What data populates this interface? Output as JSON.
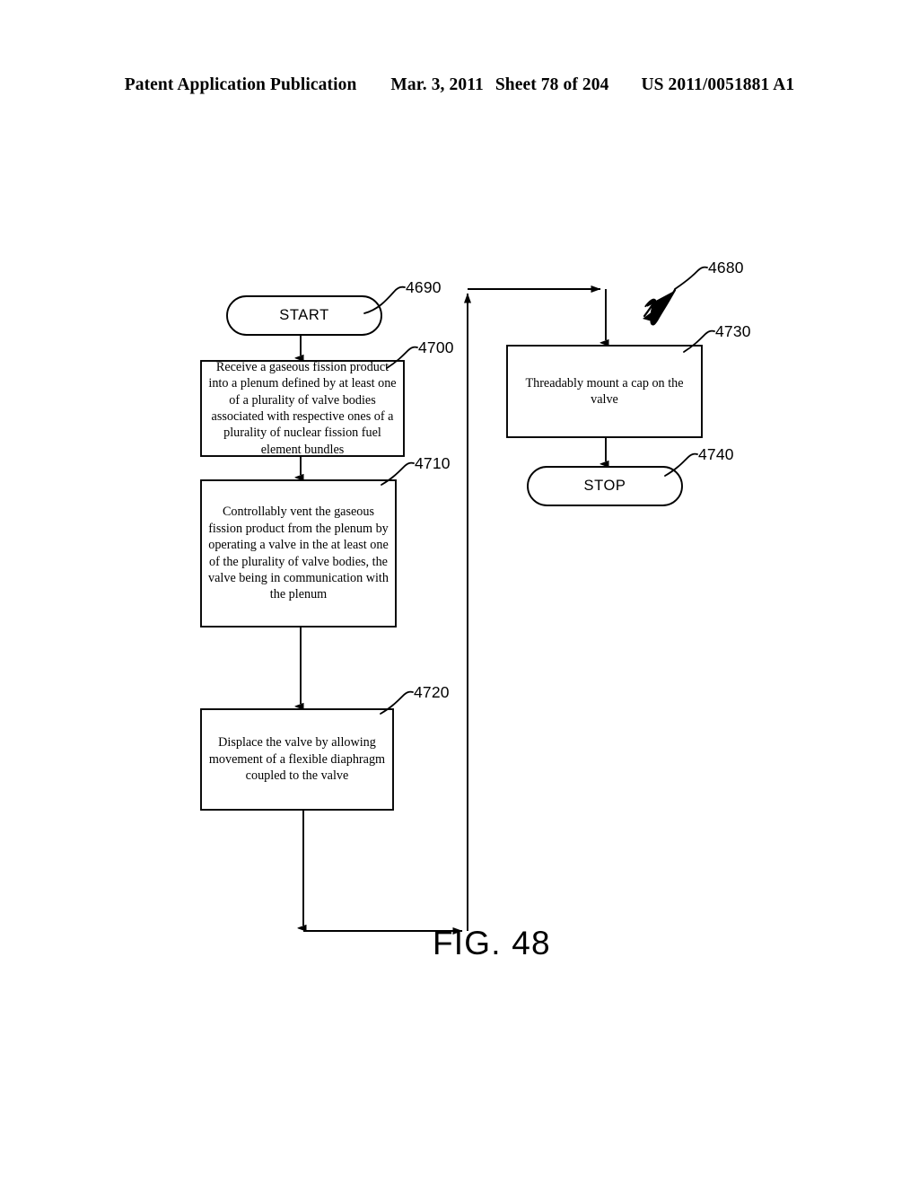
{
  "header": {
    "publication": "Patent Application Publication",
    "date": "Mar. 3, 2011",
    "sheet": "Sheet 78 of 204",
    "patent_number": "US 2011/0051881 A1"
  },
  "figure": {
    "caption": "FIG. 48",
    "diagram_label": "4680"
  },
  "nodes": {
    "start": {
      "ref": "4690",
      "label": "START",
      "shape": "terminal"
    },
    "step_4700": {
      "ref": "4700",
      "label": "Receive a gaseous fission product into a plenum defined by at least one of a plurality of valve bodies associated with respective ones of a plurality of nuclear fission fuel element bundles",
      "shape": "process"
    },
    "step_4710": {
      "ref": "4710",
      "label": "Controllably vent the gaseous fission product from the plenum by operating a valve in the at least one of the plurality of valve bodies, the valve being in communication with the plenum",
      "shape": "process"
    },
    "step_4720": {
      "ref": "4720",
      "label": "Displace the valve by allowing movement of a flexible diaphragm coupled to the valve",
      "shape": "process"
    },
    "step_4730": {
      "ref": "4730",
      "label": "Threadably mount a cap on the valve",
      "shape": "process"
    },
    "stop": {
      "ref": "4740",
      "label": "STOP",
      "shape": "terminal"
    }
  },
  "colors": {
    "ink": "#000000",
    "paper": "#ffffff"
  }
}
